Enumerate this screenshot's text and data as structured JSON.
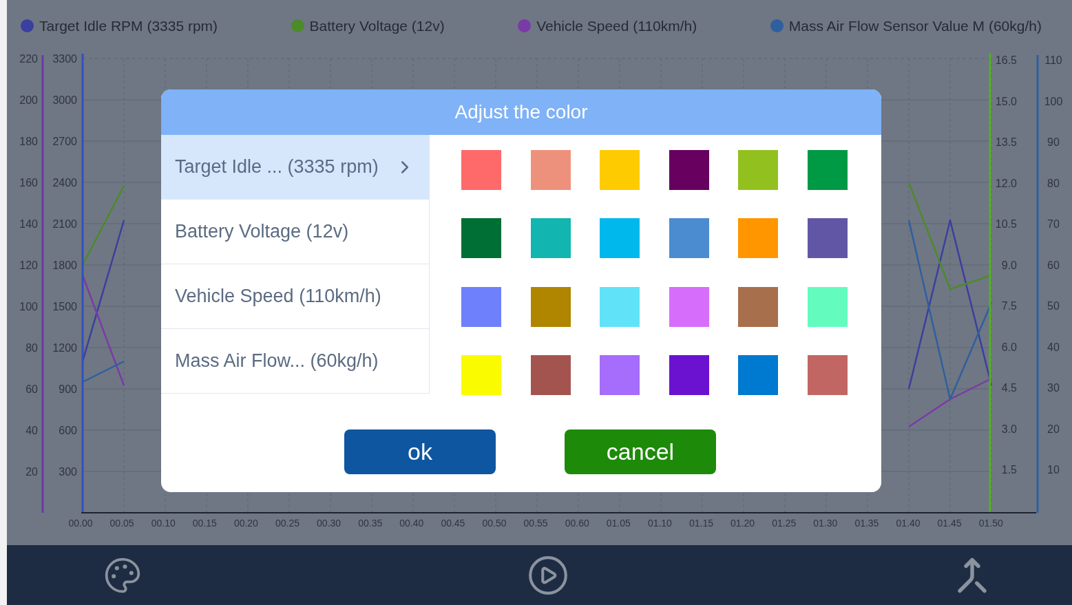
{
  "chart": {
    "left_axis_outer": [
      "220",
      "200",
      "180",
      "160",
      "140",
      "120",
      "100",
      "80",
      "60",
      "40",
      "20"
    ],
    "right_axis_inner": [
      "16.5",
      "15.0",
      "13.5",
      "12.0",
      "10.5",
      "9.0",
      "7.5",
      "6.0",
      "4.5",
      "3.0",
      "1.5"
    ],
    "right_axis_outer": [
      "110",
      "100",
      "90",
      "80",
      "70",
      "60",
      "50",
      "40",
      "30",
      "20",
      "10"
    ],
    "chart_data": {
      "type": "line",
      "grid": true,
      "categories": [
        "00.00",
        "00.05",
        "00.10",
        "00.15",
        "00.20",
        "00.25",
        "00.30",
        "00.35",
        "00.40",
        "00.45",
        "00.50",
        "00.55",
        "00.60",
        "01.05",
        "01.10",
        "01.15",
        "01.20",
        "01.25",
        "01.30",
        "01.35",
        "01.40",
        "01.45",
        "01.50"
      ],
      "ylim": [
        0,
        3300
      ],
      "yticks": [
        300,
        600,
        900,
        1200,
        1500,
        1800,
        2100,
        2400,
        2700,
        3000,
        3300
      ],
      "series": [
        {
          "name": "Target Idle RPM (3335 rpm)",
          "color": "#3b3f9e",
          "values": [
            1100,
            2125,
            null,
            null,
            null,
            null,
            null,
            null,
            null,
            null,
            null,
            null,
            null,
            null,
            null,
            null,
            null,
            null,
            null,
            null,
            900,
            2125,
            925
          ]
        },
        {
          "name": "Battery Voltage (12v)",
          "color": "#4d8a2a",
          "values": [
            1800,
            2375,
            null,
            null,
            null,
            null,
            null,
            null,
            null,
            null,
            null,
            null,
            null,
            null,
            null,
            null,
            null,
            null,
            null,
            null,
            2400,
            1625,
            1725
          ]
        },
        {
          "name": "Vehicle Speed (110km/h)",
          "color": "#7a3aa8",
          "values": [
            1725,
            925,
            null,
            null,
            null,
            null,
            null,
            null,
            null,
            null,
            null,
            null,
            null,
            null,
            null,
            null,
            null,
            null,
            null,
            null,
            625,
            825,
            975
          ]
        },
        {
          "name": "Mass Air Flow Sensor Value M (60kg/h)",
          "color": "#2f5f9e",
          "values": [
            950,
            1100,
            null,
            null,
            null,
            null,
            null,
            null,
            null,
            null,
            null,
            null,
            null,
            null,
            null,
            null,
            null,
            null,
            null,
            null,
            2125,
            825,
            1525
          ]
        }
      ]
    }
  },
  "dialog": {
    "title": "Adjust the color",
    "series": [
      {
        "label": "Target Idle ... (3335 rpm)",
        "selected": true
      },
      {
        "label": "Battery Voltage (12v)",
        "selected": false
      },
      {
        "label": "Vehicle Speed (110km/h)",
        "selected": false
      },
      {
        "label": "Mass Air Flow... (60kg/h)",
        "selected": false
      }
    ],
    "swatches": [
      {
        "color": "#fe6a6a"
      },
      {
        "color": "#ee917c"
      },
      {
        "color": "#fecb00"
      },
      {
        "color": "#67005f"
      },
      {
        "color": "#92c11f"
      },
      {
        "color": "#009a44"
      },
      {
        "color": "#006f35"
      },
      {
        "color": "#12b5b0"
      },
      {
        "color": "#00b8ec"
      },
      {
        "color": "#4a8ccf"
      },
      {
        "color": "#ff9600"
      },
      {
        "color": "#6156a6"
      },
      {
        "color": "#6e80fb"
      },
      {
        "color": "#b08500"
      },
      {
        "color": "#60e3f9"
      },
      {
        "color": "#d66efb"
      },
      {
        "color": "#a86f4c"
      },
      {
        "color": "#63fcbe"
      },
      {
        "color": "#fbfb00"
      },
      {
        "color": "#a4544f"
      },
      {
        "color": "#a66cfb"
      },
      {
        "color": "#6a12d0"
      },
      {
        "color": "#0079d0"
      },
      {
        "color": "#c26663"
      }
    ],
    "buttons": [
      {
        "label": "ok",
        "kind": "confirm"
      },
      {
        "label": "cancel",
        "kind": "dismiss"
      }
    ]
  }
}
